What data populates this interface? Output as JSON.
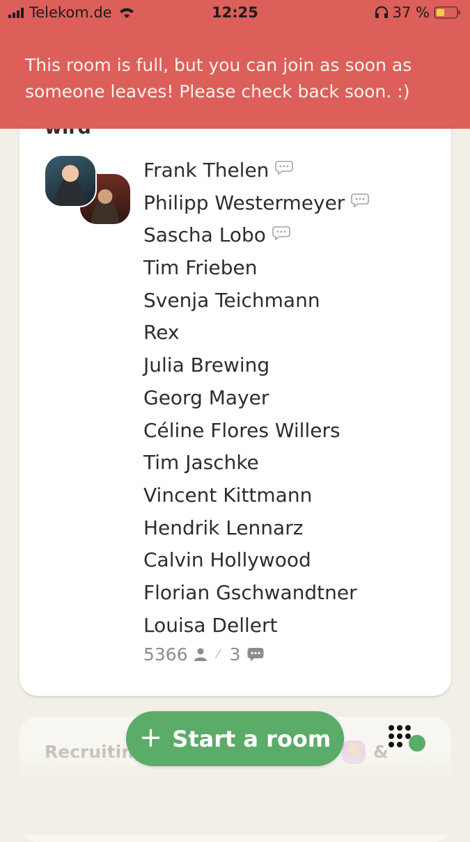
{
  "status_bar": {
    "carrier": "Telekom.de",
    "time": "12:25",
    "battery": "37 %"
  },
  "banner": {
    "message": "This room is full, but you can join as soon as someone leaves! Please check back soon. :)"
  },
  "room": {
    "partial_title": "wird",
    "speakers": [
      {
        "name": "Frank Thelen",
        "chat": true
      },
      {
        "name": "Philipp Westermeyer",
        "chat": true
      },
      {
        "name": "Sascha Lobo",
        "chat": true
      },
      {
        "name": "Tim Frieben",
        "chat": false
      },
      {
        "name": "Svenja Teichmann",
        "chat": false
      },
      {
        "name": "Rex",
        "chat": false
      },
      {
        "name": "Julia Brewing",
        "chat": false
      },
      {
        "name": "Georg Mayer",
        "chat": false
      },
      {
        "name": "Céline Flores Willers",
        "chat": false
      },
      {
        "name": "Tim Jaschke",
        "chat": false
      },
      {
        "name": "Vincent Kittmann",
        "chat": false
      },
      {
        "name": "Hendrik Lennarz",
        "chat": false
      },
      {
        "name": "Calvin Hollywood",
        "chat": false
      },
      {
        "name": "Florian Gschwandtner",
        "chat": false
      },
      {
        "name": "Louisa Dellert",
        "chat": false
      }
    ],
    "listener_count": "5366",
    "speaker_count": "3"
  },
  "next_room": {
    "title_partial": "Recruiting",
    "amp": "&"
  },
  "start_room": {
    "label": "Start a room"
  },
  "colors": {
    "banner": "#dc5f5a",
    "accent_green": "#5aac68",
    "background": "#f1efe6"
  }
}
